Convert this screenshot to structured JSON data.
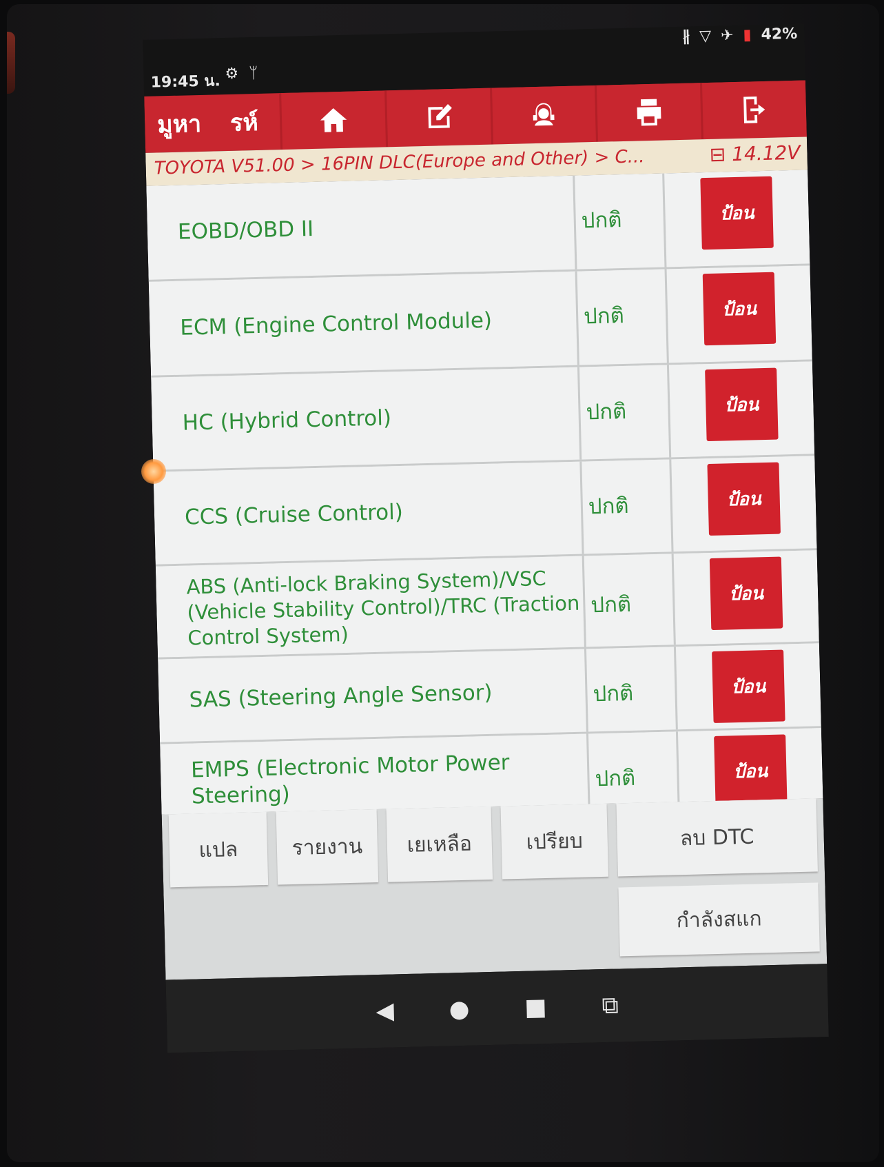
{
  "status_bar": {
    "time": "19:45 น.",
    "left_icons": [
      "settings-icon",
      "stethoscope-icon"
    ],
    "right_icons": [
      "bluetooth-icon",
      "wifi-icon",
      "airplane-icon",
      "battery-icon"
    ],
    "battery": "42%"
  },
  "header": {
    "title_left": "มูหา",
    "title_right": "รห์",
    "toolbar": [
      "home-icon",
      "edit-icon",
      "support-icon",
      "print-icon",
      "exit-icon"
    ]
  },
  "breadcrumb": {
    "path": "TOYOTA V51.00 > 16PIN DLC(Europe and Other) > C...",
    "voltage": "14.12V"
  },
  "systems": [
    {
      "name": "EOBD/OBD II",
      "status": "ปกติ",
      "button": "ป้อน"
    },
    {
      "name": "ECM (Engine Control Module)",
      "status": "ปกติ",
      "button": "ป้อน"
    },
    {
      "name": "HC (Hybrid Control)",
      "status": "ปกติ",
      "button": "ป้อน"
    },
    {
      "name": "CCS (Cruise Control)",
      "status": "ปกติ",
      "button": "ป้อน"
    },
    {
      "name": "ABS (Anti-lock Braking System)/VSC (Vehicle Stability Control)/TRC (Traction Control System)",
      "status": "ปกติ",
      "button": "ป้อน"
    },
    {
      "name": "SAS (Steering Angle Sensor)",
      "status": "ปกติ",
      "button": "ป้อน"
    },
    {
      "name": "EMPS (Electronic Motor Power Steering)",
      "status": "ปกติ",
      "button": "ป้อน"
    }
  ],
  "actions": {
    "translate": "แปล",
    "report": "รายงาน",
    "remaining": "เยเหลือ",
    "compare": "เปรียบ",
    "clear_dtc": "ลบ DTC",
    "scanning": "กำลังสแก"
  },
  "nav_icons": [
    "back-icon",
    "home-circle-icon",
    "recents-icon",
    "screenshot-icon"
  ]
}
